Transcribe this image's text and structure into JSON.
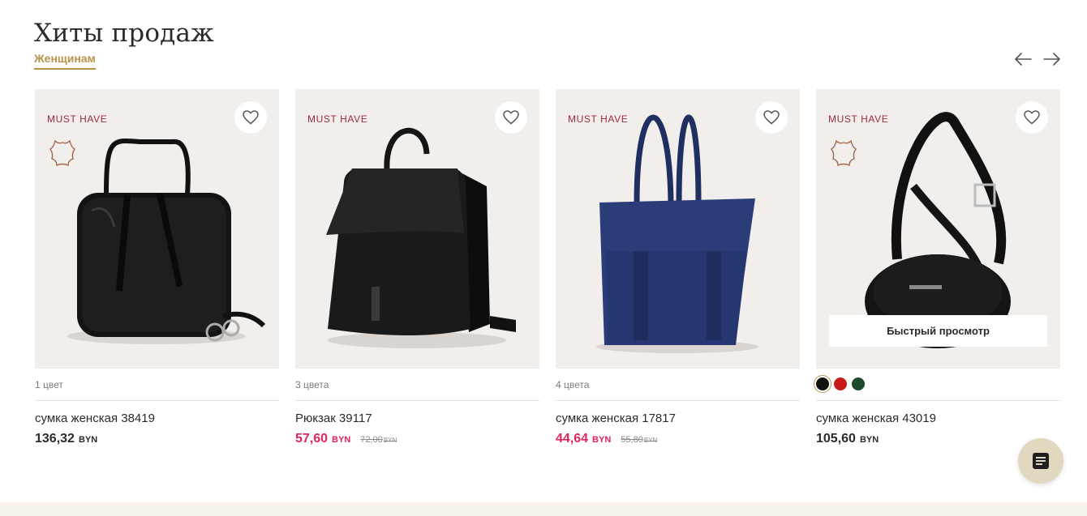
{
  "section": {
    "title": "Хиты продаж",
    "tab": "Женщинам"
  },
  "products": [
    {
      "badge": "MUST HAVE",
      "colors_label": "1 цвет",
      "name": "сумка женская 38419",
      "price": "136,32",
      "currency": "BYN"
    },
    {
      "badge": "MUST HAVE",
      "colors_label": "3 цвета",
      "name": "Рюкзак 39117",
      "price": "57,60",
      "currency": "BYN",
      "old_price": "72,00",
      "old_currency": "BYN"
    },
    {
      "badge": "MUST HAVE",
      "colors_label": "4 цвета",
      "name": "сумка женская 17817",
      "price": "44,64",
      "currency": "BYN",
      "old_price": "55,80",
      "old_currency": "BYN"
    },
    {
      "badge": "MUST HAVE",
      "quick_view": "Быстрый просмотр",
      "swatches": [
        "#111111",
        "#c91a1a",
        "#1d4a2b"
      ],
      "name": "сумка женская 43019",
      "price": "105,60",
      "currency": "BYN"
    }
  ],
  "icons": {
    "favorite": "heart-icon",
    "leather": "leather-hide-icon",
    "prev": "arrow-left-icon",
    "next": "arrow-right-icon",
    "chat": "chat-icon"
  },
  "colors": {
    "accent_gold": "#b8924a",
    "badge_red": "#9a2b3c",
    "sale_pink": "#e0245e",
    "card_bg": "#f1eeec",
    "chat_bg": "#e2d7bf"
  }
}
